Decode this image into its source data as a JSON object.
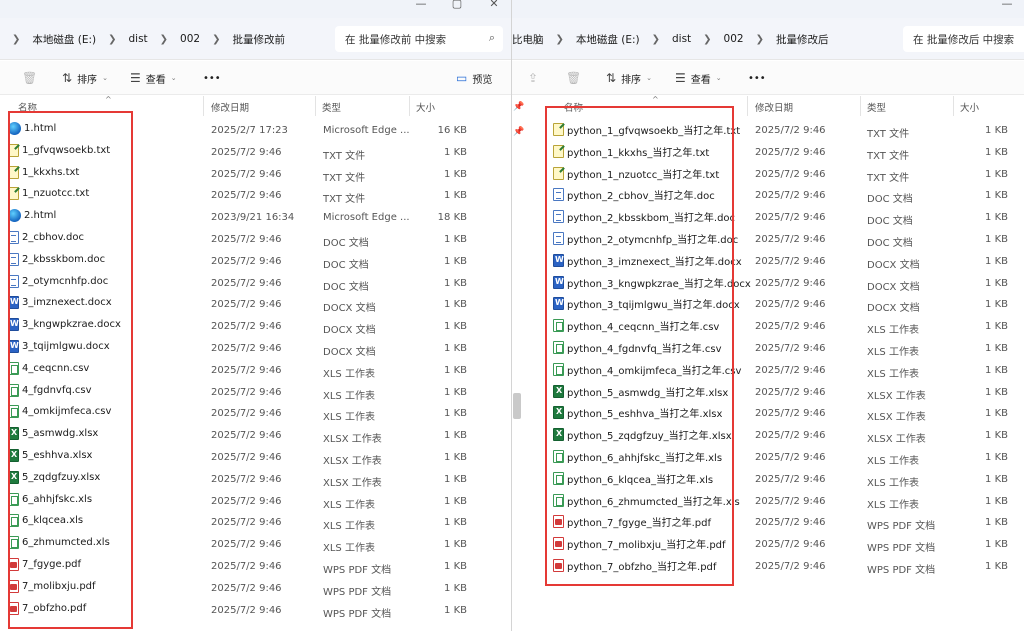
{
  "left": {
    "breadcrumb": [
      "本地磁盘 (E:)",
      "dist",
      "002",
      "批量修改前"
    ],
    "search_placeholder": "在 批量修改前 中搜索",
    "toolbar": {
      "sort": "排序",
      "view": "查看",
      "more": "•••",
      "preview": "预览"
    },
    "columns": {
      "name": "名称",
      "date": "修改日期",
      "type": "类型",
      "size": "大小"
    },
    "files": [
      {
        "name": "1.html",
        "date": "2025/2/7 17:23",
        "type": "Microsoft Edge ...",
        "size": "16 KB",
        "icon": "html"
      },
      {
        "name": "1_gfvqwsoekb.txt",
        "date": "2025/7/2 9:46",
        "type": "TXT 文件",
        "size": "1 KB",
        "icon": "txt"
      },
      {
        "name": "1_kkxhs.txt",
        "date": "2025/7/2 9:46",
        "type": "TXT 文件",
        "size": "1 KB",
        "icon": "txt"
      },
      {
        "name": "1_nzuotcc.txt",
        "date": "2025/7/2 9:46",
        "type": "TXT 文件",
        "size": "1 KB",
        "icon": "txt"
      },
      {
        "name": "2.html",
        "date": "2023/9/21 16:34",
        "type": "Microsoft Edge ...",
        "size": "18 KB",
        "icon": "html"
      },
      {
        "name": "2_cbhov.doc",
        "date": "2025/7/2 9:46",
        "type": "DOC 文档",
        "size": "1 KB",
        "icon": "doc"
      },
      {
        "name": "2_kbsskbom.doc",
        "date": "2025/7/2 9:46",
        "type": "DOC 文档",
        "size": "1 KB",
        "icon": "doc"
      },
      {
        "name": "2_otymcnhfp.doc",
        "date": "2025/7/2 9:46",
        "type": "DOC 文档",
        "size": "1 KB",
        "icon": "doc"
      },
      {
        "name": "3_imznexect.docx",
        "date": "2025/7/2 9:46",
        "type": "DOCX 文档",
        "size": "1 KB",
        "icon": "docx"
      },
      {
        "name": "3_kngwpkzrae.docx",
        "date": "2025/7/2 9:46",
        "type": "DOCX 文档",
        "size": "1 KB",
        "icon": "docx"
      },
      {
        "name": "3_tqijmlgwu.docx",
        "date": "2025/7/2 9:46",
        "type": "DOCX 文档",
        "size": "1 KB",
        "icon": "docx"
      },
      {
        "name": "4_ceqcnn.csv",
        "date": "2025/7/2 9:46",
        "type": "XLS 工作表",
        "size": "1 KB",
        "icon": "xls"
      },
      {
        "name": "4_fgdnvfq.csv",
        "date": "2025/7/2 9:46",
        "type": "XLS 工作表",
        "size": "1 KB",
        "icon": "xls"
      },
      {
        "name": "4_omkijmfeca.csv",
        "date": "2025/7/2 9:46",
        "type": "XLS 工作表",
        "size": "1 KB",
        "icon": "xls"
      },
      {
        "name": "5_asmwdg.xlsx",
        "date": "2025/7/2 9:46",
        "type": "XLSX 工作表",
        "size": "1 KB",
        "icon": "xlsx"
      },
      {
        "name": "5_eshhva.xlsx",
        "date": "2025/7/2 9:46",
        "type": "XLSX 工作表",
        "size": "1 KB",
        "icon": "xlsx"
      },
      {
        "name": "5_zqdgfzuy.xlsx",
        "date": "2025/7/2 9:46",
        "type": "XLSX 工作表",
        "size": "1 KB",
        "icon": "xlsx"
      },
      {
        "name": "6_ahhjfskc.xls",
        "date": "2025/7/2 9:46",
        "type": "XLS 工作表",
        "size": "1 KB",
        "icon": "xls"
      },
      {
        "name": "6_klqcea.xls",
        "date": "2025/7/2 9:46",
        "type": "XLS 工作表",
        "size": "1 KB",
        "icon": "xls"
      },
      {
        "name": "6_zhmumcted.xls",
        "date": "2025/7/2 9:46",
        "type": "XLS 工作表",
        "size": "1 KB",
        "icon": "xls"
      },
      {
        "name": "7_fgyge.pdf",
        "date": "2025/7/2 9:46",
        "type": "WPS PDF 文档",
        "size": "1 KB",
        "icon": "pdf"
      },
      {
        "name": "7_molibxju.pdf",
        "date": "2025/7/2 9:46",
        "type": "WPS PDF 文档",
        "size": "1 KB",
        "icon": "pdf"
      },
      {
        "name": "7_obfzho.pdf",
        "date": "2025/7/2 9:46",
        "type": "WPS PDF 文档",
        "size": "1 KB",
        "icon": "pdf"
      }
    ]
  },
  "right": {
    "breadcrumb_lead": "比电脑",
    "breadcrumb": [
      "本地磁盘 (E:)",
      "dist",
      "002",
      "批量修改后"
    ],
    "search_placeholder": "在 批量修改后 中搜索",
    "toolbar": {
      "sort": "排序",
      "view": "查看",
      "more": "•••"
    },
    "columns": {
      "name": "名称",
      "date": "修改日期",
      "type": "类型",
      "size": "大小"
    },
    "files": [
      {
        "name": "python_1_gfvqwsoekb_当打之年.txt",
        "date": "2025/7/2 9:46",
        "type": "TXT 文件",
        "size": "1 KB",
        "icon": "txt"
      },
      {
        "name": "python_1_kkxhs_当打之年.txt",
        "date": "2025/7/2 9:46",
        "type": "TXT 文件",
        "size": "1 KB",
        "icon": "txt"
      },
      {
        "name": "python_1_nzuotcc_当打之年.txt",
        "date": "2025/7/2 9:46",
        "type": "TXT 文件",
        "size": "1 KB",
        "icon": "txt"
      },
      {
        "name": "python_2_cbhov_当打之年.doc",
        "date": "2025/7/2 9:46",
        "type": "DOC 文档",
        "size": "1 KB",
        "icon": "doc"
      },
      {
        "name": "python_2_kbsskbom_当打之年.doc",
        "date": "2025/7/2 9:46",
        "type": "DOC 文档",
        "size": "1 KB",
        "icon": "doc"
      },
      {
        "name": "python_2_otymcnhfp_当打之年.doc",
        "date": "2025/7/2 9:46",
        "type": "DOC 文档",
        "size": "1 KB",
        "icon": "doc"
      },
      {
        "name": "python_3_imznexect_当打之年.docx",
        "date": "2025/7/2 9:46",
        "type": "DOCX 文档",
        "size": "1 KB",
        "icon": "docx"
      },
      {
        "name": "python_3_kngwpkzrae_当打之年.docx",
        "date": "2025/7/2 9:46",
        "type": "DOCX 文档",
        "size": "1 KB",
        "icon": "docx"
      },
      {
        "name": "python_3_tqijmlgwu_当打之年.docx",
        "date": "2025/7/2 9:46",
        "type": "DOCX 文档",
        "size": "1 KB",
        "icon": "docx"
      },
      {
        "name": "python_4_ceqcnn_当打之年.csv",
        "date": "2025/7/2 9:46",
        "type": "XLS 工作表",
        "size": "1 KB",
        "icon": "xls"
      },
      {
        "name": "python_4_fgdnvfq_当打之年.csv",
        "date": "2025/7/2 9:46",
        "type": "XLS 工作表",
        "size": "1 KB",
        "icon": "xls"
      },
      {
        "name": "python_4_omkijmfeca_当打之年.csv",
        "date": "2025/7/2 9:46",
        "type": "XLS 工作表",
        "size": "1 KB",
        "icon": "xls"
      },
      {
        "name": "python_5_asmwdg_当打之年.xlsx",
        "date": "2025/7/2 9:46",
        "type": "XLSX 工作表",
        "size": "1 KB",
        "icon": "xlsx"
      },
      {
        "name": "python_5_eshhva_当打之年.xlsx",
        "date": "2025/7/2 9:46",
        "type": "XLSX 工作表",
        "size": "1 KB",
        "icon": "xlsx"
      },
      {
        "name": "python_5_zqdgfzuy_当打之年.xlsx",
        "date": "2025/7/2 9:46",
        "type": "XLSX 工作表",
        "size": "1 KB",
        "icon": "xlsx"
      },
      {
        "name": "python_6_ahhjfskc_当打之年.xls",
        "date": "2025/7/2 9:46",
        "type": "XLS 工作表",
        "size": "1 KB",
        "icon": "xls"
      },
      {
        "name": "python_6_klqcea_当打之年.xls",
        "date": "2025/7/2 9:46",
        "type": "XLS 工作表",
        "size": "1 KB",
        "icon": "xls"
      },
      {
        "name": "python_6_zhmumcted_当打之年.xls",
        "date": "2025/7/2 9:46",
        "type": "XLS 工作表",
        "size": "1 KB",
        "icon": "xls"
      },
      {
        "name": "python_7_fgyge_当打之年.pdf",
        "date": "2025/7/2 9:46",
        "type": "WPS PDF 文档",
        "size": "1 KB",
        "icon": "pdf"
      },
      {
        "name": "python_7_molibxju_当打之年.pdf",
        "date": "2025/7/2 9:46",
        "type": "WPS PDF 文档",
        "size": "1 KB",
        "icon": "pdf"
      },
      {
        "name": "python_7_obfzho_当打之年.pdf",
        "date": "2025/7/2 9:46",
        "type": "WPS PDF 文档",
        "size": "1 KB",
        "icon": "pdf"
      }
    ]
  },
  "highlight_color": "#e53935"
}
